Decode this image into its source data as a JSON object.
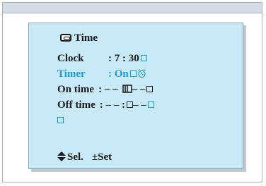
{
  "menu": {
    "title": "Time",
    "clock": {
      "label": "Clock",
      "value": ": 7 : 30"
    },
    "timer": {
      "label": "Timer",
      "value": ": On"
    },
    "on_time": {
      "label": "On time",
      "value": ": – –",
      "after_icon": "– –"
    },
    "off_time": {
      "label": "Off time",
      "value": ": – – :",
      "after_box": "– –"
    }
  },
  "controls": {
    "select_label": "Sel.",
    "set_symbol": "±",
    "set_label": "Set"
  },
  "colors": {
    "panel": "#c8e9f7",
    "highlight": "#1a9ad6",
    "text": "#1a1a1a"
  }
}
